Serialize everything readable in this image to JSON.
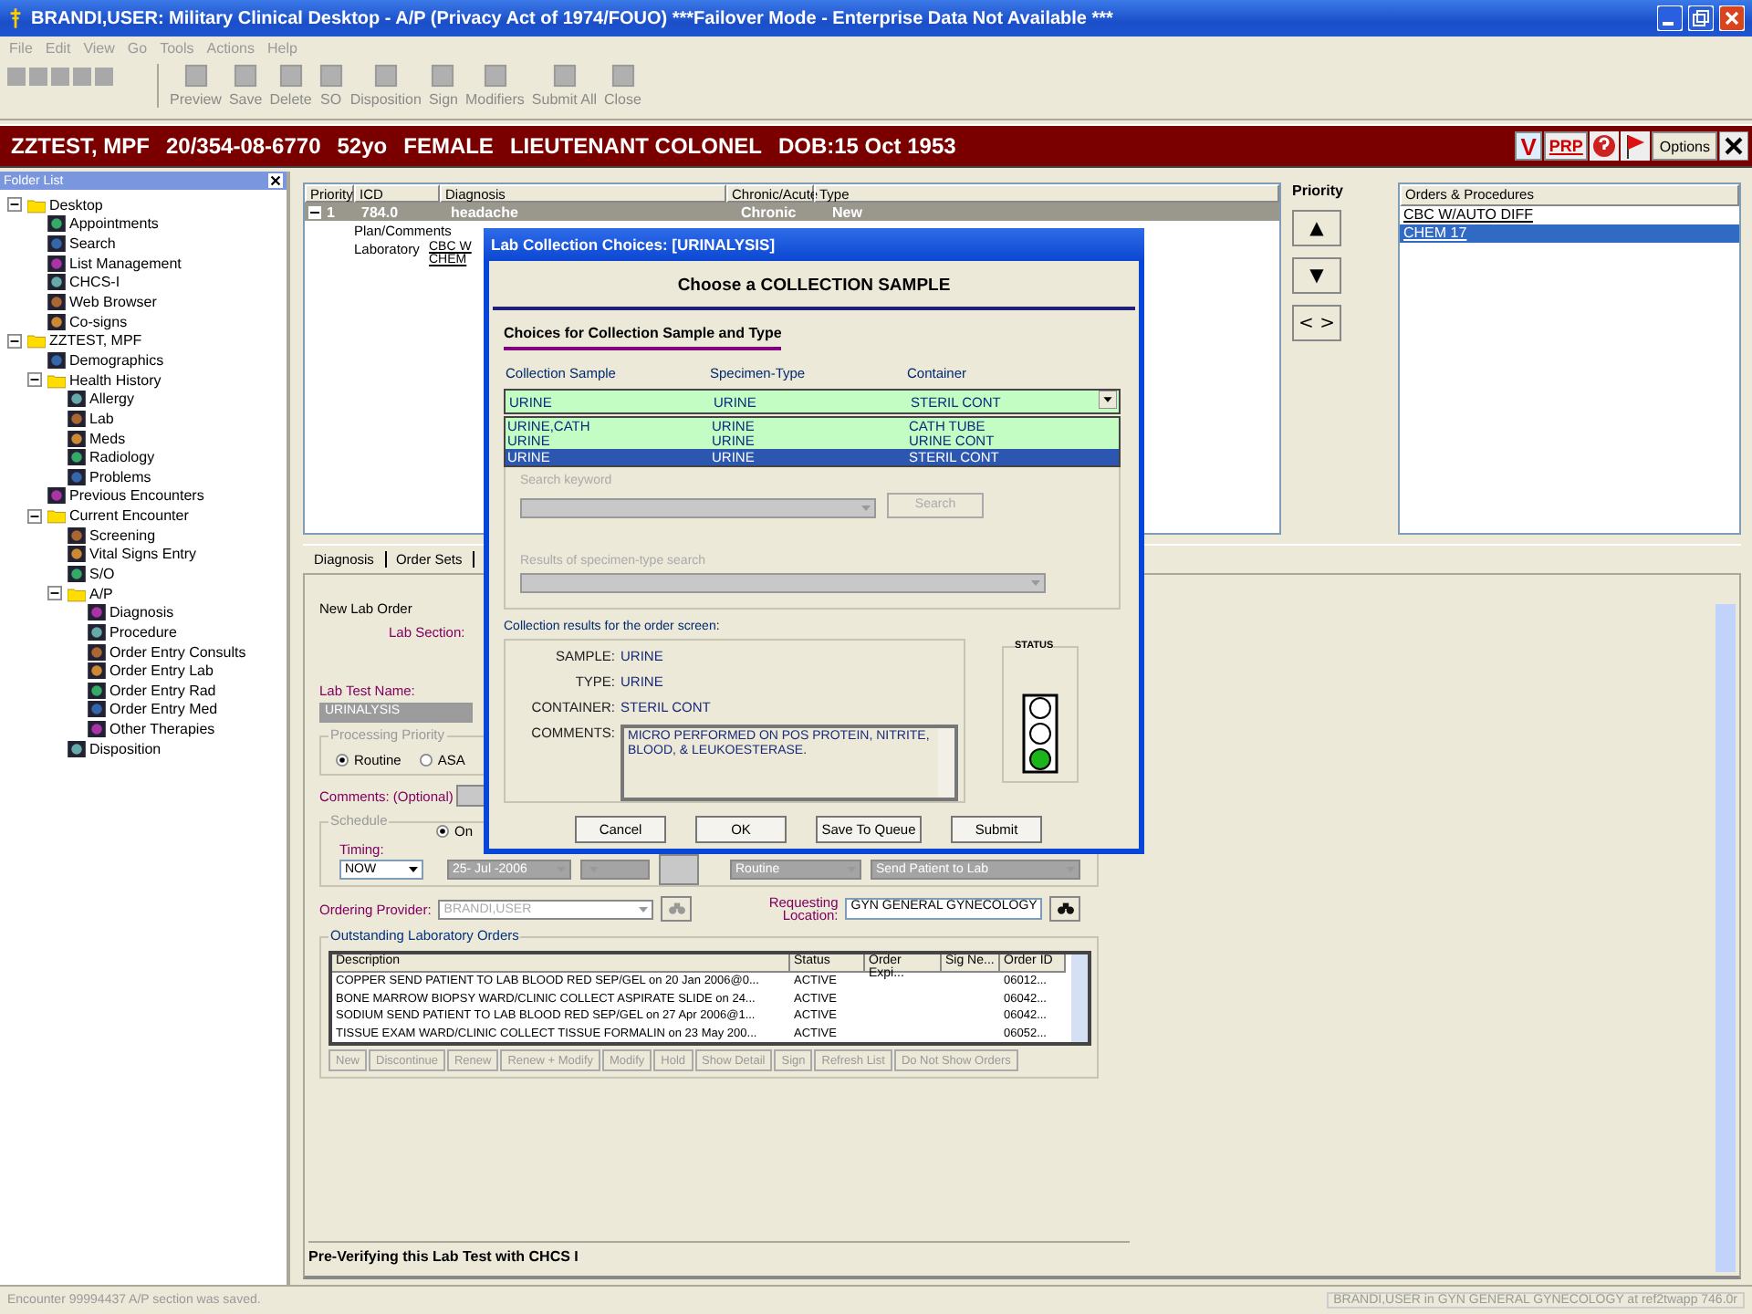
{
  "window": {
    "title": "BRANDI,USER: Military Clinical Desktop - A/P (Privacy Act of 1974/FOUO) ***Failover Mode - Enterprise Data Not Available ***"
  },
  "menu": [
    {
      "label": "File",
      "disabled": true
    },
    {
      "label": "Edit",
      "disabled": true
    },
    {
      "label": "View",
      "disabled": true
    },
    {
      "label": "Go",
      "disabled": true
    },
    {
      "label": "Tools",
      "disabled": true
    },
    {
      "label": "Actions",
      "disabled": true
    },
    {
      "label": "Help",
      "disabled": true
    }
  ],
  "toolbar": [
    {
      "label": "Preview",
      "disabled": true
    },
    {
      "label": "Save",
      "disabled": true
    },
    {
      "label": "Delete",
      "disabled": true
    },
    {
      "label": "SO",
      "disabled": true
    },
    {
      "label": "Disposition",
      "disabled": true
    },
    {
      "label": "Sign",
      "disabled": true
    },
    {
      "label": "Modifiers",
      "disabled": true
    },
    {
      "label": "Submit All",
      "disabled": true
    },
    {
      "label": "Close",
      "disabled": true
    }
  ],
  "patient_banner": {
    "name": "ZZTEST, MPF",
    "ssn": "20/354-08-6770",
    "age": "52yo",
    "sex": "FEMALE",
    "rank": "LIEUTENANT COLONEL",
    "dob": "DOB:15 Oct 1953",
    "flags": [
      "V",
      "PRP"
    ],
    "options": "Options"
  },
  "folder_list": {
    "title": "Folder List",
    "items": [
      {
        "label": "Desktop",
        "kind": "folder",
        "expanded": true,
        "children": [
          {
            "label": "Appointments",
            "kind": "item"
          },
          {
            "label": "Search",
            "kind": "item"
          },
          {
            "label": "List Management",
            "kind": "item"
          },
          {
            "label": "CHCS-I",
            "kind": "item"
          },
          {
            "label": "Web Browser",
            "kind": "item"
          },
          {
            "label": "Co-signs",
            "kind": "item"
          }
        ]
      },
      {
        "label": "ZZTEST, MPF",
        "kind": "folder",
        "expanded": true,
        "children": [
          {
            "label": "Demographics",
            "kind": "item"
          },
          {
            "label": "Health History",
            "kind": "folder",
            "expanded": true,
            "children": [
              {
                "label": "Allergy",
                "kind": "item"
              },
              {
                "label": "Lab",
                "kind": "item"
              },
              {
                "label": "Meds",
                "kind": "item"
              },
              {
                "label": "Radiology",
                "kind": "item"
              },
              {
                "label": "Problems",
                "kind": "item"
              }
            ]
          },
          {
            "label": "Previous Encounters",
            "kind": "item"
          },
          {
            "label": "Current Encounter",
            "kind": "folder",
            "expanded": true,
            "children": [
              {
                "label": "Screening",
                "kind": "item"
              },
              {
                "label": "Vital Signs Entry",
                "kind": "item"
              },
              {
                "label": "S/O",
                "kind": "item"
              },
              {
                "label": "A/P",
                "kind": "folder",
                "expanded": true,
                "children": [
                  {
                    "label": "Diagnosis",
                    "kind": "item"
                  },
                  {
                    "label": "Procedure",
                    "kind": "item"
                  },
                  {
                    "label": "Order Entry Consults",
                    "kind": "item"
                  },
                  {
                    "label": "Order Entry Lab",
                    "kind": "item"
                  },
                  {
                    "label": "Order Entry Rad",
                    "kind": "item"
                  },
                  {
                    "label": "Order Entry Med",
                    "kind": "item"
                  },
                  {
                    "label": "Other Therapies",
                    "kind": "item"
                  }
                ]
              },
              {
                "label": "Disposition",
                "kind": "item"
              }
            ]
          }
        ]
      }
    ]
  },
  "problems": {
    "columns": [
      "Priority",
      "ICD",
      "Diagnosis",
      "Chronic/Acute",
      "Type"
    ],
    "rows": [
      {
        "priority": "1",
        "icd": "784.0",
        "diagnosis": "headache",
        "chronicity": "Chronic",
        "type": "New",
        "selected": true,
        "expanded": true
      }
    ],
    "details": [
      {
        "label": "Plan/Comments"
      },
      {
        "label": "Laboratory",
        "orders": [
          "CBC W",
          "CHEM"
        ]
      }
    ]
  },
  "priority_panel": {
    "title": "Priority",
    "buttons": [
      "▲",
      "▼",
      "< >"
    ]
  },
  "orders_procedures": {
    "title": "Orders & Procedures",
    "items": [
      {
        "label": "CBC W/AUTO DIFF",
        "selected": false
      },
      {
        "label": "CHEM 17",
        "selected": true
      }
    ]
  },
  "tabs": [
    {
      "label": "Diagnosis",
      "selected": false
    },
    {
      "label": "Order Sets",
      "selected": false
    }
  ],
  "lab_order": {
    "title": "New Lab Order",
    "lab_section_label": "Lab Section:",
    "test_name_label": "Lab Test Name:",
    "test_name": "URINALYSIS",
    "processing_priority": {
      "legend": "Processing Priority",
      "options": [
        {
          "label": "Routine",
          "selected": true
        },
        {
          "label": "ASA",
          "selected": false
        }
      ]
    },
    "comments_label": "Comments: (Optional)",
    "schedule": {
      "legend": "Schedule",
      "options": [
        {
          "label": "On",
          "selected": true
        }
      ],
      "timing_label": "Timing:",
      "timing": "NOW",
      "start_date": "25- Jul -2006",
      "collection_priority": "Routine",
      "collection_method": "Send Patient to Lab"
    },
    "ordering_provider_label": "Ordering Provider:",
    "ordering_provider": "BRANDI,USER",
    "requesting_location_label": "Requesting Location:",
    "requesting_location": "GYN GENERAL GYNECOLOGY"
  },
  "outstanding_orders": {
    "legend": "Outstanding Laboratory Orders",
    "columns": [
      "Description",
      "Status",
      "Order Expi...",
      "Sig Ne...",
      "Order ID"
    ],
    "rows": [
      {
        "description": "COPPER SEND PATIENT TO LAB BLOOD RED SEP/GEL on 20 Jan 2006@0...",
        "status": "ACTIVE",
        "order_id": "06012..."
      },
      {
        "description": "BONE MARROW BIOPSY WARD/CLINIC COLLECT ASPIRATE SLIDE on 24...",
        "status": "ACTIVE",
        "order_id": "06042..."
      },
      {
        "description": "SODIUM SEND PATIENT TO LAB BLOOD RED SEP/GEL on 27 Apr 2006@1...",
        "status": "ACTIVE",
        "order_id": "06042..."
      },
      {
        "description": "TISSUE EXAM WARD/CLINIC COLLECT TISSUE FORMALIN on 23 May 200...",
        "status": "ACTIVE",
        "order_id": "06052..."
      }
    ],
    "buttons": [
      {
        "label": "New",
        "disabled": true
      },
      {
        "label": "Discontinue",
        "disabled": true
      },
      {
        "label": "Renew",
        "disabled": true
      },
      {
        "label": "Renew + Modify",
        "disabled": true
      },
      {
        "label": "Modify",
        "disabled": true
      },
      {
        "label": "Hold",
        "disabled": true
      },
      {
        "label": "Show Detail",
        "disabled": true
      },
      {
        "label": "Sign",
        "disabled": true
      },
      {
        "label": "Refresh List",
        "disabled": true
      },
      {
        "label": "Do Not Show Orders",
        "disabled": true
      }
    ]
  },
  "status_message": "Pre-Verifying this Lab Test with CHCS I",
  "dialog": {
    "title": "Lab Collection Choices: [URINALYSIS]",
    "heading": "Choose a COLLECTION SAMPLE",
    "section": "Choices for Collection Sample and Type",
    "columns": [
      "Collection Sample",
      "Specimen-Type",
      "Container"
    ],
    "current": [
      "URINE",
      "URINE",
      "STERIL CONT"
    ],
    "options": [
      {
        "cells": [
          "URINE,CATH",
          "URINE",
          "CATH TUBE"
        ],
        "selected": false
      },
      {
        "cells": [
          "URINE",
          "URINE",
          "URINE CONT"
        ],
        "selected": false
      },
      {
        "cells": [
          "URINE",
          "URINE",
          "STERIL CONT"
        ],
        "selected": true
      }
    ],
    "search_label": "Search keyword",
    "search_button": "Search",
    "results_search_label": "Results of specimen-type search",
    "results_heading": "Collection results for the order screen:",
    "results": [
      {
        "label": "SAMPLE:",
        "value": "URINE"
      },
      {
        "label": "TYPE:",
        "value": "URINE"
      },
      {
        "label": "CONTAINER:",
        "value": "STERIL CONT"
      }
    ],
    "comments_label": "COMMENTS:",
    "comments": "MICRO PERFORMED ON POS PROTEIN, NITRITE, BLOOD, & LEUKOESTERASE.",
    "status": {
      "label": "STATUS",
      "lights": [
        {
          "on": false
        },
        {
          "on": false
        },
        {
          "on": true
        }
      ]
    },
    "buttons": [
      "Cancel",
      "OK",
      "Save To Queue",
      "Submit"
    ]
  },
  "status_bar": {
    "left": "Encounter 99994437 A/P section was saved.",
    "right": "BRANDI,USER in GYN GENERAL GYNECOLOGY at ref2twapp 746.0r"
  }
}
